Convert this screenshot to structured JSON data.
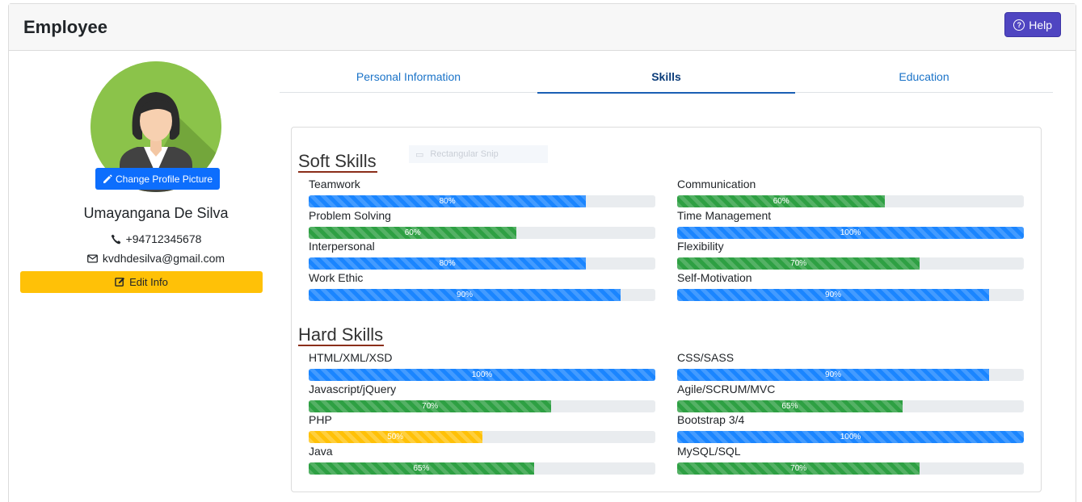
{
  "header": {
    "title": "Employee",
    "help_label": "Help"
  },
  "profile": {
    "change_picture_label": "Change Profile Picture",
    "name": "Umayangana De Silva",
    "phone": "+94712345678",
    "email": "kvdhdesilva@gmail.com",
    "edit_label": "Edit Info"
  },
  "tabs": [
    {
      "label": "Personal Information",
      "active": false
    },
    {
      "label": "Skills",
      "active": true
    },
    {
      "label": "Education",
      "active": false
    }
  ],
  "ghost_label": "Rectangular Snip",
  "soft_skills": {
    "title": "Soft Skills",
    "items": [
      {
        "label": "Teamwork",
        "percent": 80,
        "text": "80%",
        "variant": "primary"
      },
      {
        "label": "Communication",
        "percent": 60,
        "text": "60%",
        "variant": "success"
      },
      {
        "label": "Problem Solving",
        "percent": 60,
        "text": "60%",
        "variant": "success"
      },
      {
        "label": "Time Management",
        "percent": 100,
        "text": "100%",
        "variant": "primary"
      },
      {
        "label": "Interpersonal",
        "percent": 80,
        "text": "80%",
        "variant": "primary"
      },
      {
        "label": "Flexibility",
        "percent": 70,
        "text": "70%",
        "variant": "success"
      },
      {
        "label": "Work Ethic",
        "percent": 90,
        "text": "90%",
        "variant": "primary"
      },
      {
        "label": "Self-Motivation",
        "percent": 90,
        "text": "90%",
        "variant": "primary"
      }
    ]
  },
  "hard_skills": {
    "title": "Hard Skills",
    "items": [
      {
        "label": "HTML/XML/XSD",
        "percent": 100,
        "text": "100%",
        "variant": "primary"
      },
      {
        "label": "CSS/SASS",
        "percent": 90,
        "text": "90%",
        "variant": "primary"
      },
      {
        "label": "Javascript/jQuery",
        "percent": 70,
        "text": "70%",
        "variant": "success"
      },
      {
        "label": "Agile/SCRUM/MVC",
        "percent": 65,
        "text": "65%",
        "variant": "success"
      },
      {
        "label": "PHP",
        "percent": 50,
        "text": "50%",
        "variant": "warning"
      },
      {
        "label": "Bootstrap 3/4",
        "percent": 100,
        "text": "100%",
        "variant": "primary"
      },
      {
        "label": "Java",
        "percent": 65,
        "text": "65%",
        "variant": "success"
      },
      {
        "label": "MySQL/SQL",
        "percent": 70,
        "text": "70%",
        "variant": "success"
      }
    ]
  },
  "colors": {
    "help": "#4f45c1",
    "primary": "#1a85ff",
    "success": "#2ea043",
    "warning": "#ffc107",
    "section_underline": "#8b2e1a"
  },
  "icons": [
    "question-circle-icon",
    "pencil-icon",
    "phone-icon",
    "envelope-icon",
    "edit-square-icon",
    "avatar-woman-icon"
  ]
}
